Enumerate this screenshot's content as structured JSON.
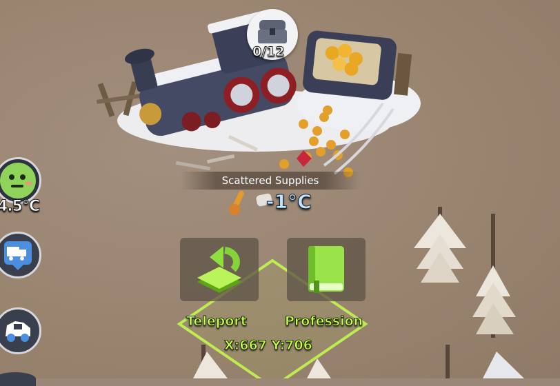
{
  "site": {
    "name": "Scattered Supplies",
    "temperature": "-1°C",
    "chest_count": "0/12"
  },
  "player": {
    "temperature": "4.5°C",
    "mood_icon": "neutral-face-icon"
  },
  "side_buttons": [
    {
      "icon": "delivery-truck-icon"
    },
    {
      "icon": "jeep-vehicle-icon"
    }
  ],
  "actions": {
    "teleport_label": "Teleport",
    "profession_label": "Profession"
  },
  "coords_text": "X:667 Y:706",
  "colors": {
    "accent_green": "#c6ff4c",
    "cold_blue": "#bfe6ff",
    "ground": "#9a8777"
  }
}
